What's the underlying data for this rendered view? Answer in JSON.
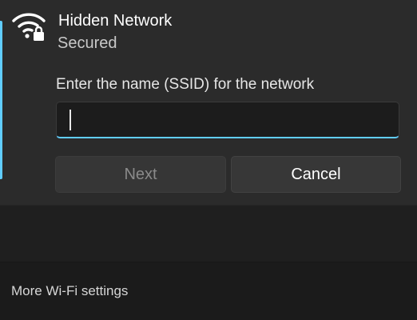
{
  "network": {
    "name": "Hidden Network",
    "status": "Secured",
    "icon": "wifi-secured-icon"
  },
  "ssid_form": {
    "label": "Enter the name (SSID) for the network",
    "value": "",
    "placeholder": ""
  },
  "buttons": {
    "next_label": "Next",
    "cancel_label": "Cancel"
  },
  "footer": {
    "settings_link": "More Wi-Fi settings"
  },
  "colors": {
    "accent": "#60cdff",
    "panel": "#2b2b2b",
    "background": "#1f1f1f"
  }
}
